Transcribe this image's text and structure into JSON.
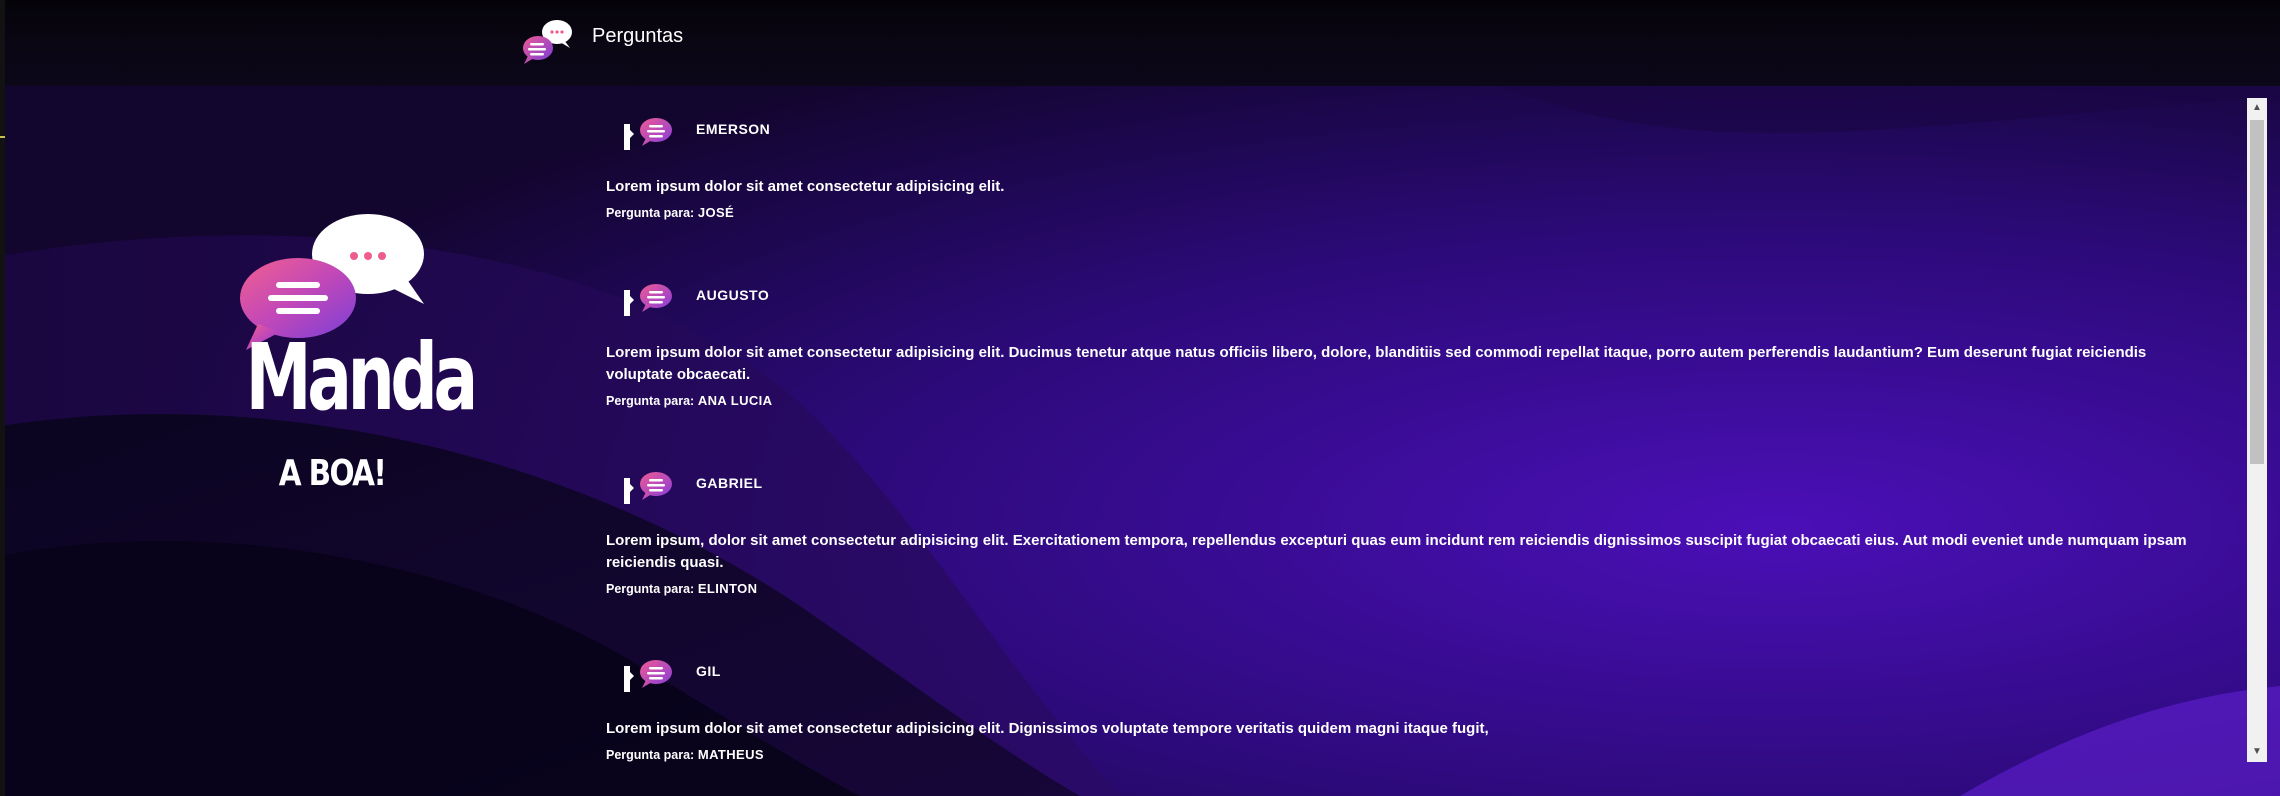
{
  "header": {
    "title": "Perguntas",
    "logo_icon": "chat-bubbles-icon"
  },
  "brand": {
    "word": "Manda",
    "subtitle": "A BOA!",
    "icon": "chat-bubbles-logo"
  },
  "colors": {
    "background": "#07040f",
    "accent_purple": "#4a10b8",
    "bubble_pink": "#ec4f96",
    "bubble_violet": "#8a3ed8"
  },
  "questions": [
    {
      "author": "EMERSON",
      "text": "Lorem ipsum dolor sit amet consectetur adipisicing elit.",
      "target_label": "Pergunta para:",
      "target": "JOSÉ"
    },
    {
      "author": "AUGUSTO",
      "text": "Lorem ipsum dolor sit amet consectetur adipisicing elit. Ducimus tenetur atque natus officiis libero, dolore, blanditiis sed commodi repellat itaque, porro autem perferendis laudantium? Eum deserunt fugiat reiciendis voluptate obcaecati.",
      "target_label": "Pergunta para:",
      "target": "ANA LUCIA"
    },
    {
      "author": "GABRIEL",
      "text": "Lorem ipsum, dolor sit amet consectetur adipisicing elit. Exercitationem tempora, repellendus excepturi quas eum incidunt rem reiciendis dignissimos suscipit fugiat obcaecati eius. Aut modi eveniet unde numquam ipsam reiciendis quasi.",
      "target_label": "Pergunta para:",
      "target": "ELINTON"
    },
    {
      "author": "GIL",
      "text": "Lorem ipsum dolor sit amet consectetur adipisicing elit. Dignissimos voluptate tempore veritatis quidem magni itaque fugit,",
      "target_label": "Pergunta para:",
      "target": "MATHEUS"
    }
  ]
}
